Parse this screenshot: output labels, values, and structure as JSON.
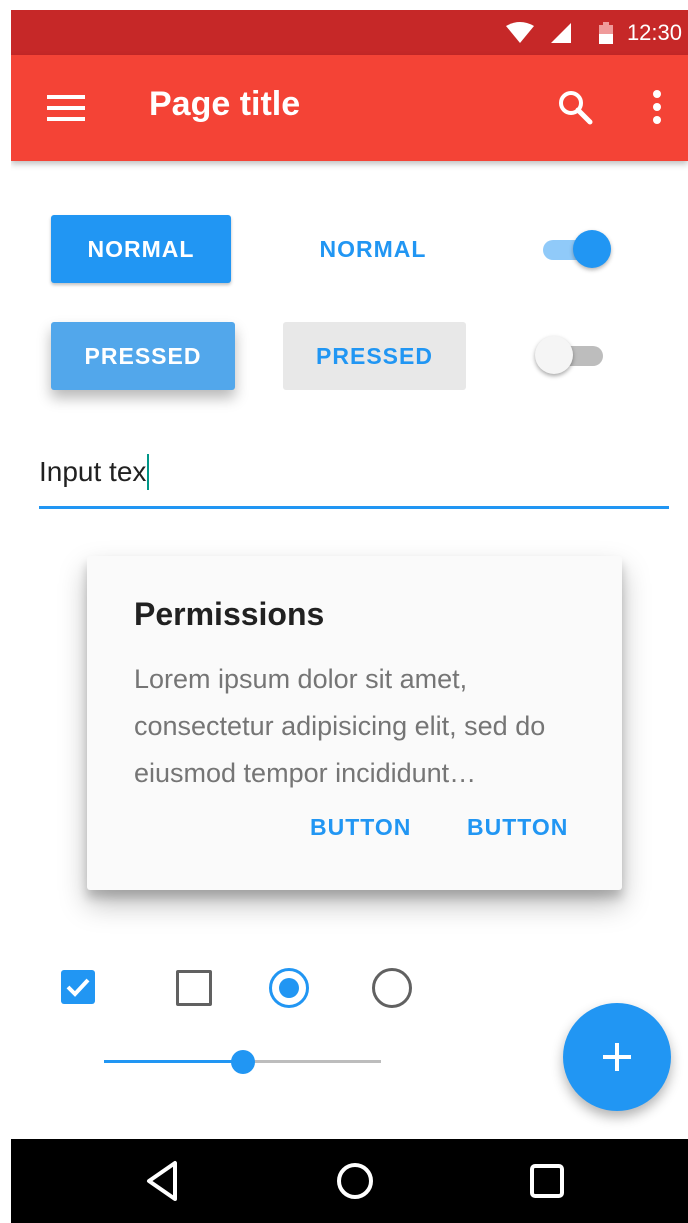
{
  "status_bar": {
    "time": "12:30",
    "icons": [
      "wifi-icon",
      "cellular-signal-icon",
      "battery-icon"
    ]
  },
  "app_bar": {
    "title": "Page title",
    "icons": [
      "menu-icon",
      "search-icon",
      "more-vert-icon"
    ]
  },
  "buttons": {
    "raised_normal": "NORMAL",
    "flat_normal": "NORMAL",
    "raised_pressed": "PRESSED",
    "flat_pressed": "PRESSED"
  },
  "switches": {
    "top_on": true,
    "bottom_on": false
  },
  "text_field": {
    "value": "Input tex"
  },
  "dialog": {
    "title": "Permissions",
    "body": "Lorem ipsum dolor sit amet, consectetur adipisicing elit, sed do eiusmod tempor incididunt…",
    "button_1": "BUTTON",
    "button_2": "BUTTON"
  },
  "controls": {
    "checkbox_1_checked": true,
    "checkbox_2_checked": false,
    "radio_1_selected": true,
    "radio_2_selected": false
  },
  "slider": {
    "value": 0.5
  },
  "fab": {
    "icon": "add-icon"
  },
  "nav_bar": {
    "icons": [
      "back-icon",
      "home-icon",
      "recents-icon"
    ]
  },
  "colors": {
    "status_bar": "#c62828",
    "app_bar": "#f44336",
    "accent": "#2196f3",
    "pressed_raised": "#52a7eb",
    "pressed_flat_bg": "#e8e8e8"
  }
}
